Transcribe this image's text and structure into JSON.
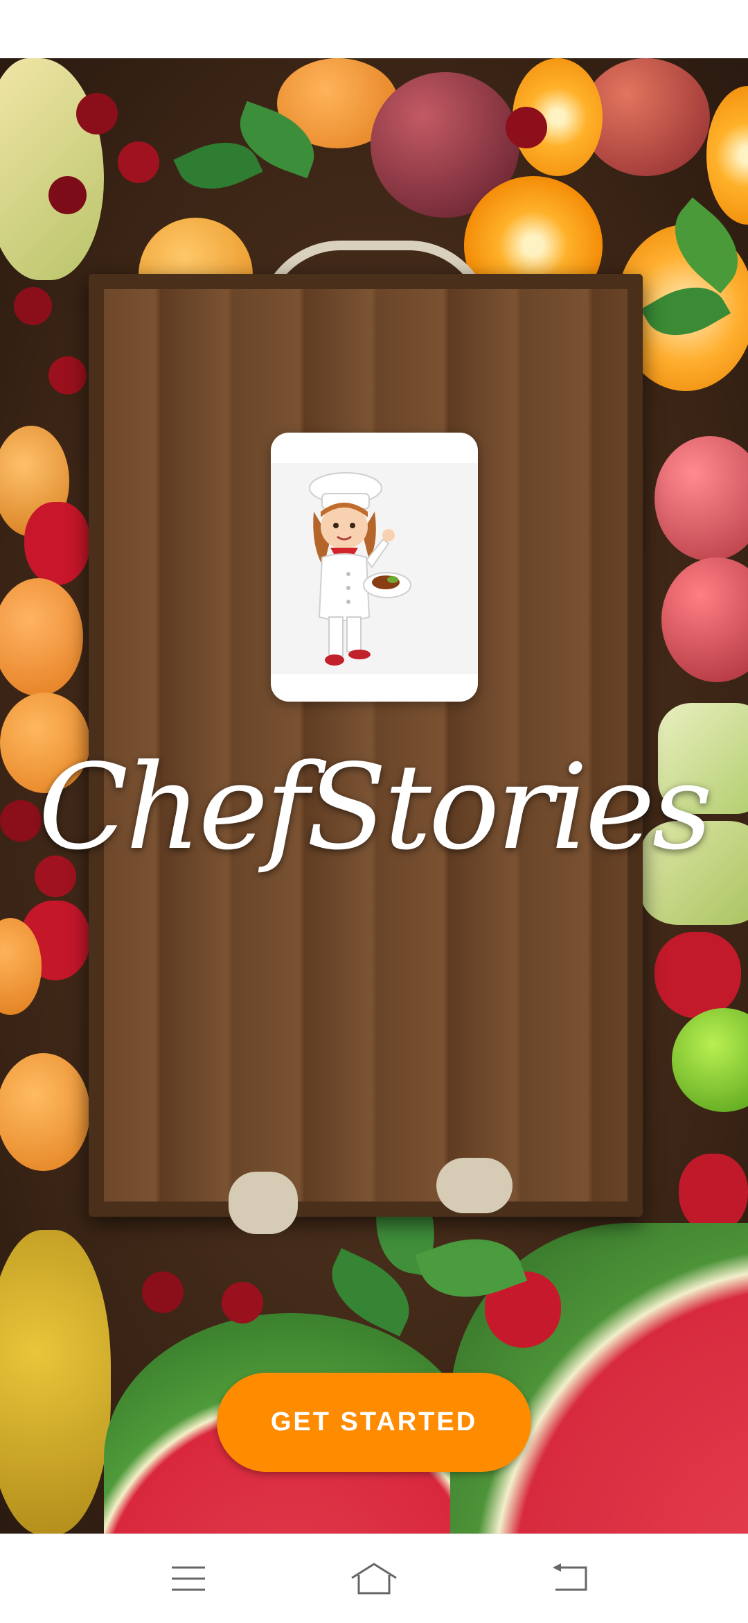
{
  "app": {
    "brand_name": "ChefStories",
    "logo_alt": "chef illustration logo"
  },
  "cta": {
    "label": "GET STARTED"
  },
  "navigation": {
    "items": [
      {
        "name": "menu-icon"
      },
      {
        "name": "home-icon"
      },
      {
        "name": "back-icon"
      }
    ]
  },
  "colors": {
    "accent": "#ff8c00",
    "wood_dark": "#3a2415",
    "text_light": "#ffffff"
  }
}
